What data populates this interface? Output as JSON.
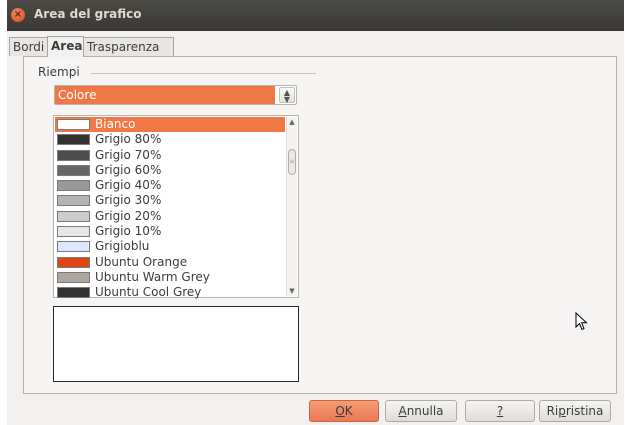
{
  "window": {
    "title": "Area del grafico"
  },
  "tabs": [
    {
      "label": "Bordi",
      "active": false
    },
    {
      "label": "Area",
      "active": true
    },
    {
      "label": "Trasparenza",
      "active": false
    }
  ],
  "fill": {
    "group_label": "Riempi",
    "selected_type": "Colore"
  },
  "colors": [
    {
      "label": "Bianco",
      "color": "#ffffff",
      "selected": true
    },
    {
      "label": "Grigio 80%",
      "color": "#333333",
      "selected": false
    },
    {
      "label": "Grigio 70%",
      "color": "#4d4d4d",
      "selected": false
    },
    {
      "label": "Grigio 60%",
      "color": "#666666",
      "selected": false
    },
    {
      "label": "Grigio 40%",
      "color": "#999999",
      "selected": false
    },
    {
      "label": "Grigio 30%",
      "color": "#b3b3b3",
      "selected": false
    },
    {
      "label": "Grigio 20%",
      "color": "#cccccc",
      "selected": false
    },
    {
      "label": "Grigio 10%",
      "color": "#e6e6e6",
      "selected": false
    },
    {
      "label": "Grigioblu",
      "color": "#dde8ff",
      "selected": false
    },
    {
      "label": "Ubuntu Orange",
      "color": "#dd4814",
      "selected": false
    },
    {
      "label": "Ubuntu Warm Grey",
      "color": "#aea79f",
      "selected": false
    },
    {
      "label": "Ubuntu Cool Grey",
      "color": "#333333",
      "selected": false
    }
  ],
  "buttons": {
    "ok": {
      "label": "OK",
      "mnemonic": "O",
      "rest": "K"
    },
    "cancel": {
      "label": "Annulla",
      "mnemonic": "A",
      "rest": "nnulla"
    },
    "help": {
      "label": "?",
      "mnemonic": "?",
      "rest": ""
    },
    "reset": {
      "label": "Ripristina",
      "pre": "Ri",
      "mnemonic": "p",
      "rest": "ristina"
    }
  },
  "accent_color": "#f07746"
}
